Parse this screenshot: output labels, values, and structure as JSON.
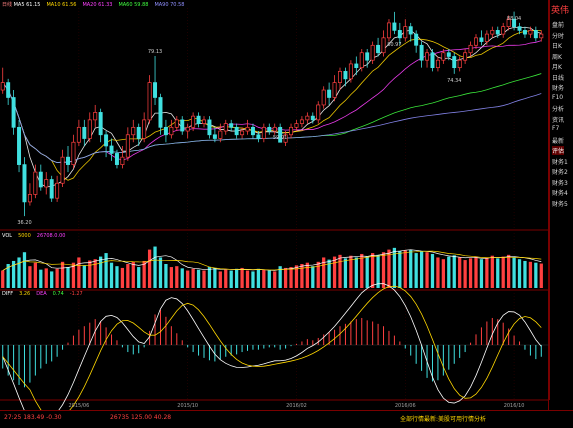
{
  "window_title": "英伟达",
  "top_legend": {
    "label": "日线",
    "ma_items": [
      {
        "text": "MA5 61.15",
        "color": "#ffffff"
      },
      {
        "text": "MA10 61.56",
        "color": "#ffd700"
      },
      {
        "text": "MA20 61.33",
        "color": "#ff40ff"
      },
      {
        "text": "MA60 59.88",
        "color": "#40ff40"
      },
      {
        "text": "MA90 70.58",
        "color": "#9090ff"
      }
    ]
  },
  "volume_legend": {
    "items": [
      {
        "text": "VOL",
        "color": "#ffffff"
      },
      {
        "text": "5000",
        "color": "#ffd700"
      },
      {
        "text": "26708.0.00",
        "color": "#ff40ff"
      }
    ]
  },
  "macd_legend": {
    "items": [
      {
        "text": "DIFF",
        "color": "#ffffff"
      },
      {
        "text": "3.26",
        "color": "#ffd700"
      },
      {
        "text": "DEA",
        "color": "#ff40ff"
      },
      {
        "text": "0.74",
        "color": "#40ff40"
      },
      {
        "text": "-1.27",
        "color": "#ff4040"
      }
    ]
  },
  "sidebar": {
    "header": "英伟",
    "items": [
      "盘前",
      "分时",
      "日K",
      "周K",
      "月K",
      "日线",
      "财务",
      "F10",
      "分析",
      "资讯",
      "F7",
      "最新",
      "评估",
      "财务1",
      "财务2",
      "财务3",
      "财务4",
      "财务5"
    ]
  },
  "price_labels": [
    "36.20",
    "79.13",
    "59.01",
    "80.97",
    "74.34",
    "88.04"
  ],
  "x_axis_dates": [
    "2015/06",
    "2015/10",
    "2016/02",
    "2016/06",
    "2016/10"
  ],
  "status_bar": {
    "left": "27:25 183.49 -0.30",
    "mid": "26735 125.00 40.28",
    "right": "全部行情最新:美股可用行情分析"
  },
  "chart_data": {
    "type": "candlestick",
    "title": "",
    "note": "price in the candle panel, volume in the middle panel, MACD in the bottom panel",
    "annotations": [
      {
        "bar": 4,
        "price": 36.2,
        "label": "36.20"
      },
      {
        "bar": 28,
        "price": 79.13,
        "label": "79.13"
      },
      {
        "bar": 51,
        "price": 59.01,
        "label": "59.01"
      },
      {
        "bar": 72,
        "price": 80.97,
        "label": "80.97"
      },
      {
        "bar": 83,
        "price": 74.34,
        "label": "74.34"
      },
      {
        "bar": 94,
        "price": 88.04,
        "label": "88.04"
      }
    ],
    "price_range": [
      33,
      92
    ],
    "candles": [
      [
        70,
        72,
        76,
        69
      ],
      [
        72,
        68,
        73,
        66
      ],
      [
        68,
        60,
        70,
        58
      ],
      [
        60,
        50,
        62,
        48
      ],
      [
        50,
        40,
        52,
        36.2
      ],
      [
        40,
        42,
        45,
        39
      ],
      [
        42,
        48,
        50,
        41
      ],
      [
        48,
        44,
        50,
        43
      ],
      [
        44,
        46,
        48,
        42
      ],
      [
        46,
        41,
        47,
        40
      ],
      [
        41,
        45,
        47,
        40
      ],
      [
        45,
        52,
        54,
        44
      ],
      [
        52,
        50,
        55,
        48
      ],
      [
        50,
        56,
        58,
        49
      ],
      [
        56,
        60,
        62,
        55
      ],
      [
        60,
        57,
        62,
        55
      ],
      [
        57,
        62,
        64,
        56
      ],
      [
        62,
        64,
        66,
        60
      ],
      [
        64,
        58,
        65,
        56
      ],
      [
        58,
        55,
        59,
        52
      ],
      [
        55,
        53,
        57,
        51
      ],
      [
        53,
        50,
        54,
        49
      ],
      [
        50,
        52,
        55,
        49
      ],
      [
        52,
        58,
        60,
        51
      ],
      [
        58,
        60,
        62,
        56
      ],
      [
        60,
        57,
        61,
        55
      ],
      [
        57,
        62,
        64,
        56
      ],
      [
        62,
        72,
        74,
        61
      ],
      [
        72,
        68,
        79.13,
        66
      ],
      [
        68,
        60,
        69,
        58
      ],
      [
        60,
        58,
        62,
        56
      ],
      [
        58,
        60,
        62,
        57
      ],
      [
        60,
        62,
        63,
        59
      ],
      [
        62,
        59,
        63,
        58
      ],
      [
        59,
        60,
        61,
        57
      ],
      [
        60,
        63,
        64,
        59
      ],
      [
        63,
        61,
        64,
        60
      ],
      [
        61,
        62,
        63,
        60
      ],
      [
        62,
        58,
        63,
        57
      ],
      [
        58,
        57,
        60,
        56
      ],
      [
        57,
        59,
        61,
        56
      ],
      [
        59,
        61,
        62,
        58
      ],
      [
        61,
        60,
        62,
        59
      ],
      [
        60,
        58,
        61,
        57
      ],
      [
        58,
        59,
        60,
        57
      ],
      [
        59,
        60,
        62,
        58
      ],
      [
        60,
        58,
        61,
        57
      ],
      [
        58,
        57,
        59,
        56
      ],
      [
        57,
        60,
        61,
        56
      ],
      [
        60,
        59,
        61,
        58
      ],
      [
        59,
        60,
        61,
        58
      ],
      [
        60,
        56,
        61,
        59.01
      ],
      [
        56,
        58,
        59,
        55
      ],
      [
        58,
        60,
        61,
        57
      ],
      [
        60,
        61,
        62,
        59
      ],
      [
        61,
        62,
        63,
        60
      ],
      [
        62,
        63,
        64,
        61
      ],
      [
        63,
        62,
        64,
        61
      ],
      [
        62,
        66,
        67,
        61
      ],
      [
        66,
        70,
        71,
        65
      ],
      [
        70,
        68,
        72,
        66
      ],
      [
        68,
        72,
        74,
        67
      ],
      [
        72,
        75,
        76,
        70
      ],
      [
        75,
        73,
        76,
        71
      ],
      [
        73,
        77,
        78,
        72
      ],
      [
        77,
        76,
        79,
        74
      ],
      [
        76,
        80,
        81,
        75
      ],
      [
        80,
        78,
        81,
        76
      ],
      [
        78,
        82,
        83,
        77
      ],
      [
        82,
        80,
        84,
        79
      ],
      [
        80,
        84,
        86,
        79
      ],
      [
        84,
        88,
        89,
        83
      ],
      [
        88,
        86,
        90.97,
        85
      ],
      [
        86,
        84,
        88,
        82
      ],
      [
        84,
        87,
        89,
        83
      ],
      [
        87,
        85,
        88,
        83
      ],
      [
        85,
        82,
        86,
        80
      ],
      [
        82,
        78,
        83,
        76
      ],
      [
        78,
        80,
        81,
        76
      ],
      [
        80,
        76,
        81,
        75
      ],
      [
        76,
        78,
        79,
        75
      ],
      [
        78,
        80,
        81,
        77
      ],
      [
        80,
        79,
        81,
        78
      ],
      [
        79,
        76,
        80,
        74.34
      ],
      [
        76,
        78,
        79,
        75
      ],
      [
        78,
        80,
        81,
        77
      ],
      [
        80,
        82,
        83,
        79
      ],
      [
        82,
        84,
        85,
        81
      ],
      [
        84,
        83,
        86,
        82
      ],
      [
        83,
        85,
        86,
        82
      ],
      [
        85,
        86,
        87,
        84
      ],
      [
        86,
        85,
        87,
        84
      ],
      [
        85,
        87,
        88,
        84
      ],
      [
        87,
        89,
        90,
        86
      ],
      [
        89,
        87,
        91.04,
        86
      ],
      [
        87,
        86,
        88,
        85
      ],
      [
        86,
        85,
        87,
        84
      ],
      [
        85,
        86,
        87,
        84
      ],
      [
        86,
        84,
        87,
        83
      ],
      [
        84,
        85,
        86,
        83
      ]
    ],
    "volume": [
      40,
      55,
      62,
      70,
      82,
      50,
      58,
      42,
      45,
      38,
      44,
      60,
      48,
      58,
      70,
      52,
      63,
      66,
      72,
      80,
      58,
      50,
      46,
      55,
      60,
      48,
      62,
      88,
      95,
      70,
      55,
      48,
      50,
      45,
      40,
      44,
      42,
      40,
      48,
      46,
      38,
      42,
      40,
      44,
      46,
      40,
      38,
      44,
      42,
      40,
      38,
      50,
      46,
      48,
      52,
      55,
      58,
      50,
      60,
      70,
      65,
      72,
      76,
      68,
      74,
      70,
      78,
      72,
      80,
      76,
      82,
      88,
      92,
      85,
      86,
      88,
      80,
      84,
      82,
      78,
      70,
      66,
      72,
      75,
      70,
      64,
      68,
      72,
      66,
      70,
      74,
      68,
      72,
      76,
      70,
      66,
      62,
      60,
      58,
      56
    ],
    "volume_range": [
      0,
      110
    ],
    "macd_bars": [
      -2.0,
      -2.6,
      -3.0,
      -3.4,
      -3.6,
      -3.2,
      -2.6,
      -2.0,
      -1.6,
      -1.4,
      -1.0,
      -0.4,
      0.2,
      0.8,
      1.3,
      1.6,
      1.9,
      2.2,
      2.0,
      1.5,
      0.9,
      0.4,
      -0.2,
      -0.6,
      -0.8,
      -0.7,
      -0.2,
      1.2,
      2.6,
      3.0,
      2.4,
      1.6,
      1.0,
      0.4,
      -0.2,
      -0.6,
      -0.9,
      -1.1,
      -1.3,
      -1.4,
      -1.2,
      -1.0,
      -0.9,
      -0.8,
      -0.6,
      -0.5,
      -0.4,
      -0.4,
      -0.3,
      -0.2,
      -0.2,
      -0.4,
      -0.3,
      -0.1,
      0.1,
      0.3,
      0.5,
      0.4,
      0.6,
      0.9,
      1.1,
      1.3,
      1.6,
      1.8,
      2.0,
      2.2,
      2.3,
      2.1,
      2.0,
      1.8,
      1.6,
      1.2,
      0.8,
      0.3,
      -0.3,
      -0.9,
      -1.6,
      -2.2,
      -2.8,
      -3.1,
      -3.0,
      -2.6,
      -2.1,
      -1.6,
      -1.1,
      -0.6,
      0.2,
      0.9,
      1.5,
      2.0,
      2.3,
      2.2,
      1.9,
      1.4,
      0.8,
      0.3,
      -0.4,
      -0.9,
      -1.2,
      -1.0
    ],
    "macd_range": [
      -4,
      4
    ],
    "x_ticks": [
      {
        "bar": 14,
        "label": "2015/06"
      },
      {
        "bar": 34,
        "label": "2015/10"
      },
      {
        "bar": 54,
        "label": "2016/02"
      },
      {
        "bar": 74,
        "label": "2016/06"
      },
      {
        "bar": 94,
        "label": "2016/10"
      }
    ],
    "colors": {
      "up": "#ff4040",
      "down": "#40e0e0",
      "ma5": "#ffffff",
      "ma10": "#ffd700",
      "ma20": "#ff40ff",
      "ma60": "#40ff40",
      "ma90": "#9090ff",
      "grid": "#7a0000"
    }
  }
}
